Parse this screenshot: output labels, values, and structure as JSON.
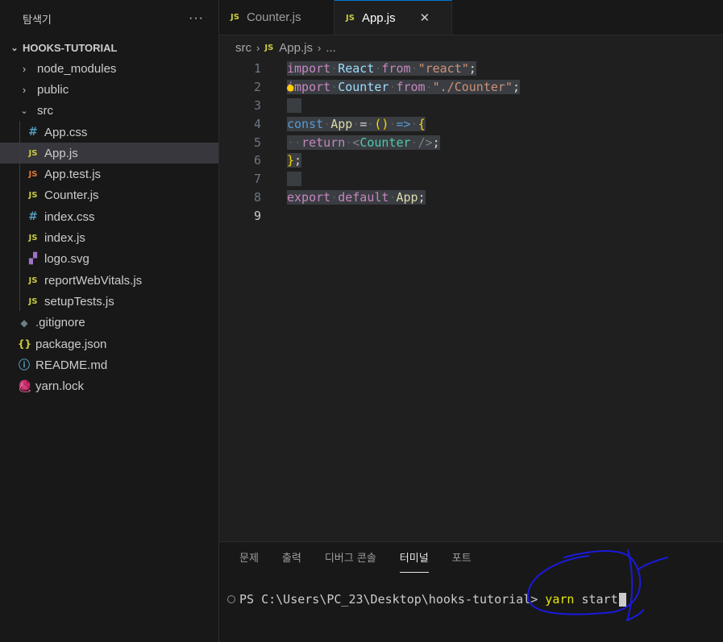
{
  "sidebar": {
    "title": "탐색기",
    "more": "···",
    "project": "HOOKS-TUTORIAL",
    "folders": [
      {
        "label": "node_modules"
      },
      {
        "label": "public"
      },
      {
        "label": "src"
      }
    ],
    "src_files": [
      {
        "label": "App.css",
        "icon": "#"
      },
      {
        "label": "App.js",
        "icon": "JS"
      },
      {
        "label": "App.test.js",
        "icon": "JS"
      },
      {
        "label": "Counter.js",
        "icon": "JS"
      },
      {
        "label": "index.css",
        "icon": "#"
      },
      {
        "label": "index.js",
        "icon": "JS"
      },
      {
        "label": "logo.svg",
        "icon": "▞"
      },
      {
        "label": "reportWebVitals.js",
        "icon": "JS"
      },
      {
        "label": "setupTests.js",
        "icon": "JS"
      }
    ],
    "root_files": [
      {
        "label": ".gitignore",
        "icon": "◆"
      },
      {
        "label": "package.json",
        "icon": "{}"
      },
      {
        "label": "README.md",
        "icon": "ⓘ"
      },
      {
        "label": "yarn.lock",
        "icon": "🧶"
      }
    ]
  },
  "tabs": [
    {
      "label": "Counter.js",
      "icon": "JS"
    },
    {
      "label": "App.js",
      "icon": "JS",
      "close": "✕"
    }
  ],
  "breadcrumb": {
    "folder": "src",
    "file": "App.js",
    "more": "...",
    "sep": "›"
  },
  "code": {
    "line_numbers": [
      "1",
      "2",
      "3",
      "4",
      "5",
      "6",
      "7",
      "8",
      "9"
    ],
    "l1": {
      "kw": "import",
      "id": "React",
      "from": "from",
      "str": "\"react\"",
      "end": ";"
    },
    "l2": {
      "kw": "import",
      "id": "Counter",
      "from": "from",
      "str": "\"./Counter\"",
      "end": ";"
    },
    "l4": {
      "kw": "const",
      "id": "App",
      "eq": "=",
      "paren": "()",
      "arrow": "=>",
      "brace": "{"
    },
    "l5": {
      "kw": "return",
      "lt": "<",
      "tag": "Counter",
      "close": "/>",
      "end": ";"
    },
    "l6": {
      "brace": "}",
      "end": ";"
    },
    "l8": {
      "kw": "export",
      "kw2": "default",
      "id": "App",
      "end": ";"
    }
  },
  "panel": {
    "tabs": [
      "문제",
      "출력",
      "디버그 콘솔",
      "터미널",
      "포트"
    ],
    "active_tab": "터미널",
    "prompt": "PS C:\\Users\\PC_23\\Desktop\\hooks-tutorial> ",
    "cmd": "yarn",
    "arg": " start"
  },
  "colors": {
    "accent": "#0078d4",
    "js_icon": "#cbcb41",
    "annotation_ink": "#1a1adc"
  }
}
